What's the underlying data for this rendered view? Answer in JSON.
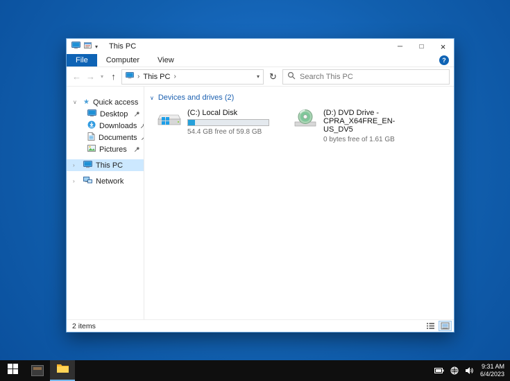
{
  "colors": {
    "accent": "#0e63b5",
    "header_blue": "#1a5fb0",
    "selection": "#cce8ff",
    "progress_fill": "#26a0da",
    "taskbar_bg": "#0f0f0f"
  },
  "window": {
    "title": "This PC",
    "controls": {
      "minimize": "─",
      "maximize": "□",
      "close": "×"
    },
    "qat_caret": "▾",
    "tabs": [
      {
        "label": "File"
      },
      {
        "label": "Computer"
      },
      {
        "label": "View"
      }
    ],
    "help": "?",
    "navbar": {
      "back": "←",
      "forward": "→",
      "recent_caret": "▾",
      "up": "↑",
      "refresh": "↻",
      "breadcrumb_separator": "›",
      "breadcrumb_root": "This PC",
      "address_caret": "▾",
      "search_placeholder": "Search This PC"
    },
    "sidebar": {
      "expanded_chevron": "∨",
      "collapsed_chevron": "›",
      "items": [
        {
          "label": "Quick access"
        },
        {
          "label": "Desktop"
        },
        {
          "label": "Downloads"
        },
        {
          "label": "Documents"
        },
        {
          "label": "Pictures"
        },
        {
          "label": "This PC"
        },
        {
          "label": "Network"
        }
      ]
    },
    "content": {
      "group_chevron": "∨",
      "group_header": "Devices and drives (2)",
      "drives": [
        {
          "name": "(C:) Local Disk",
          "free_text": "54.4 GB free of 59.8 GB",
          "used_percent": 9
        },
        {
          "name": "(D:) DVD Drive - CPRA_X64FRE_EN-US_DV5",
          "free_text": "0 bytes free of 1.61 GB"
        }
      ]
    },
    "statusbar": {
      "items_count": "2 items"
    }
  },
  "taskbar": {
    "clock_time": "9:31 AM",
    "clock_date": "6/4/2023"
  }
}
